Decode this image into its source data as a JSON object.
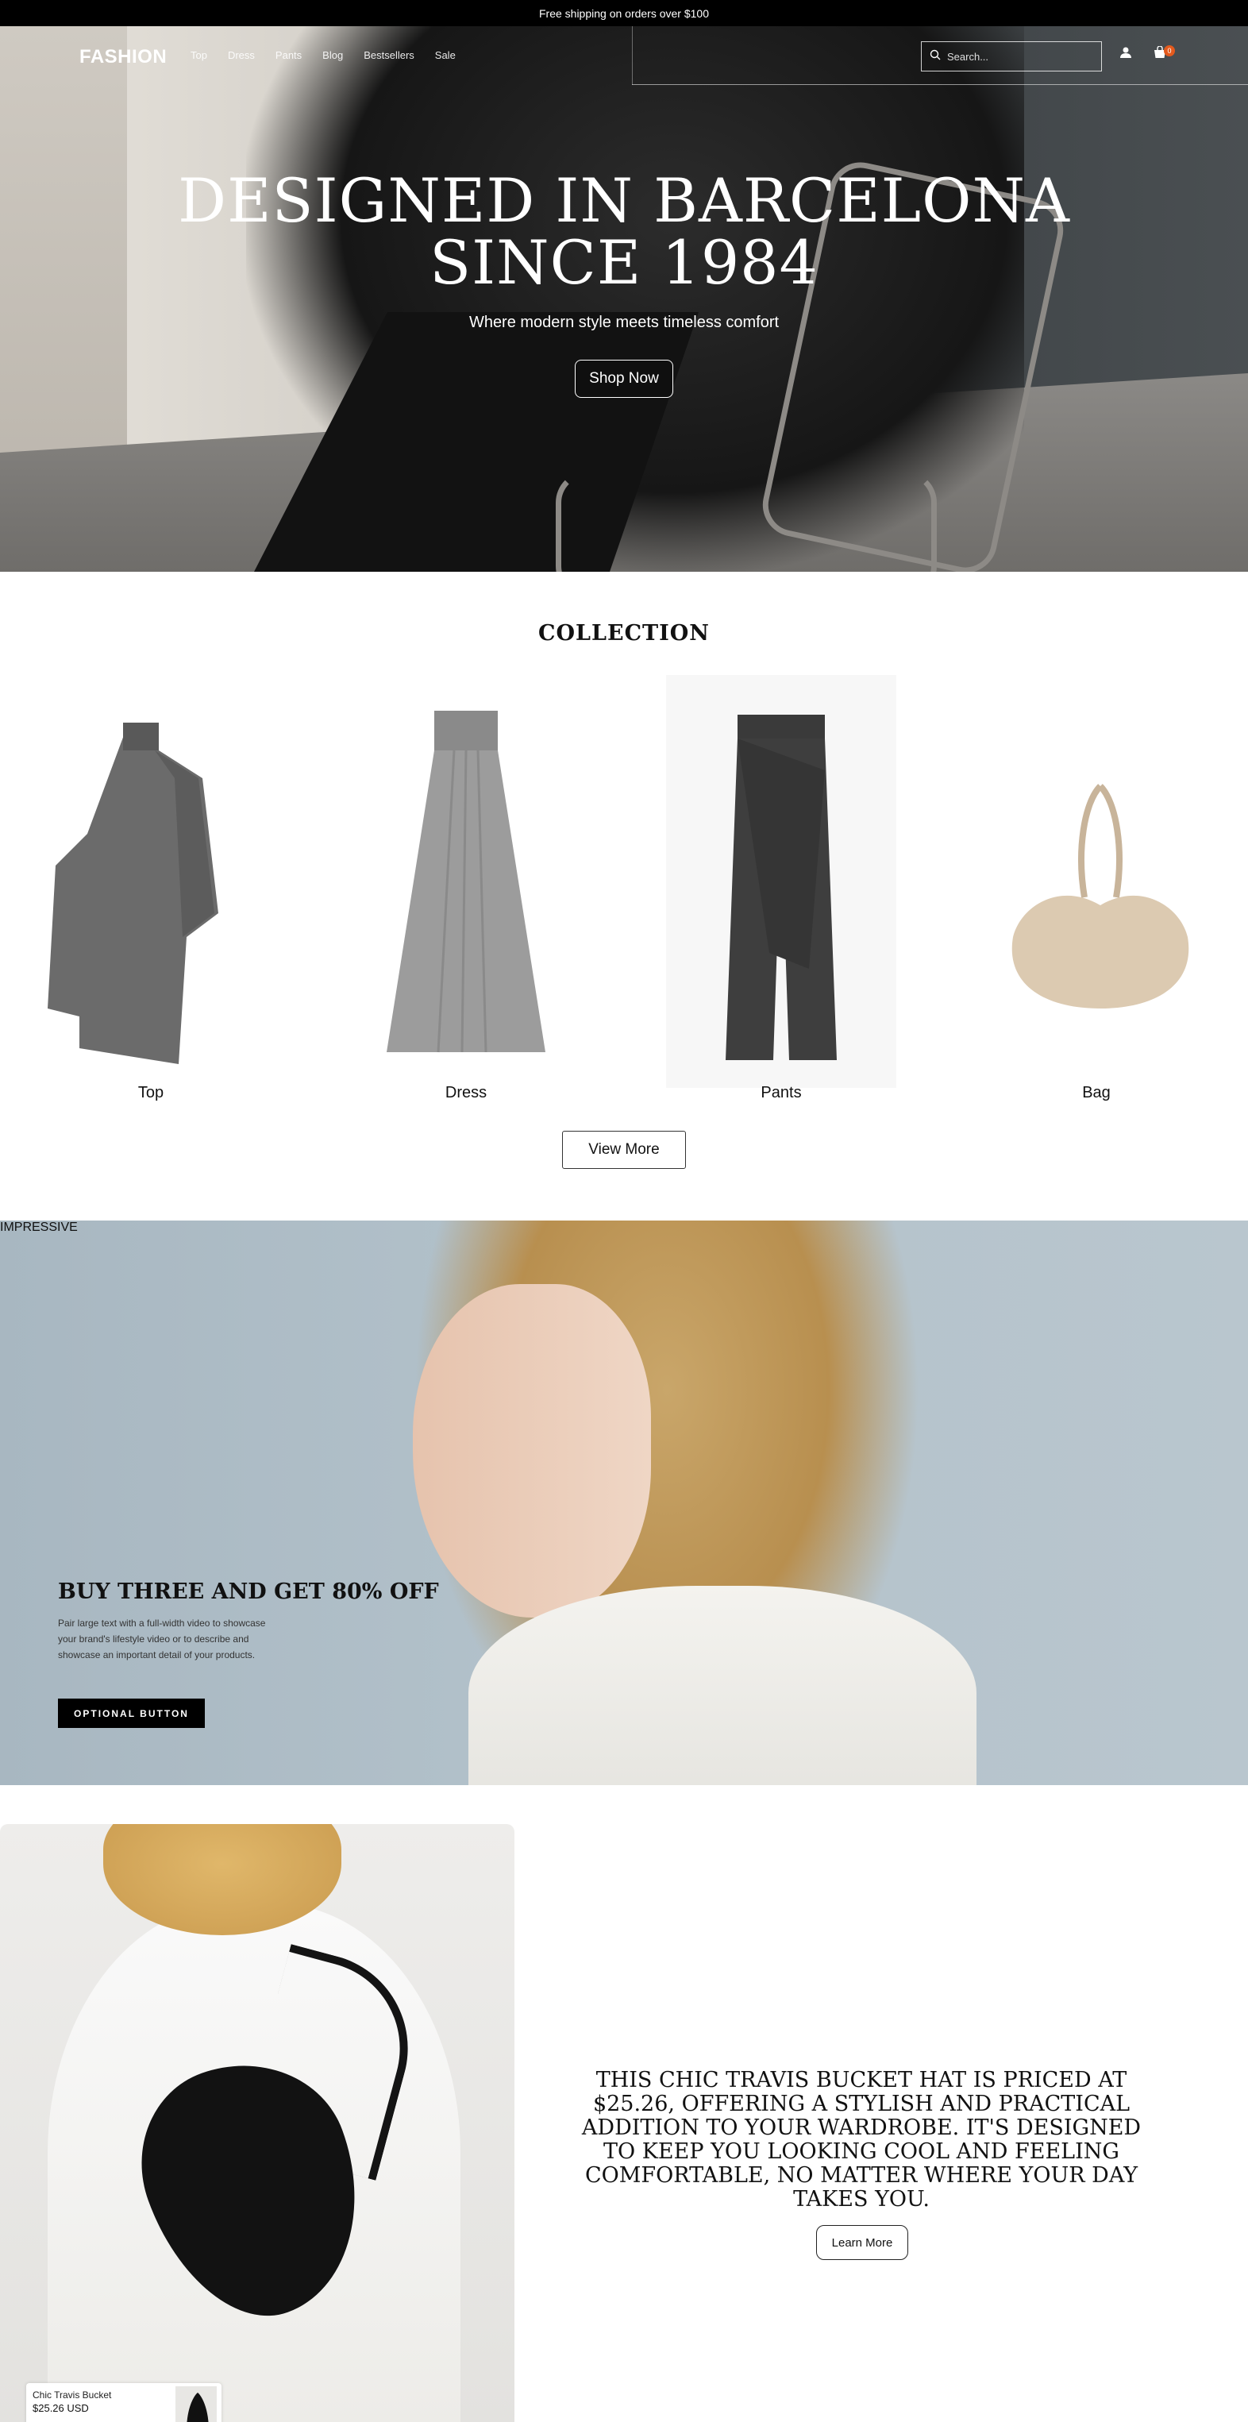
{
  "announcement": "Free shipping on orders over $100",
  "header": {
    "logo": "FASHION",
    "nav": [
      "Top",
      "Dress",
      "Pants",
      "Blog",
      "Bestsellers",
      "Sale"
    ],
    "search_placeholder": "Search...",
    "cart_count": "0"
  },
  "hero": {
    "title_line1": "DESIGNED IN BARCELONA",
    "title_line2": "SINCE 1984",
    "subtitle": "Where modern style meets timeless comfort",
    "cta": "Shop Now"
  },
  "collection": {
    "title": "COLLECTION",
    "items": [
      {
        "label": "Top"
      },
      {
        "label": "Dress"
      },
      {
        "label": "Pants"
      },
      {
        "label": "Bag"
      }
    ],
    "view_more": "View More"
  },
  "promo": {
    "kicker": "IMPRESSIVE",
    "heading": "BUY THREE AND GET 80% OFF",
    "body": "Pair large text with a full-width video to showcase your brand's lifestyle video or to describe and showcase an important detail of your products.",
    "button": "OPTIONAL BUTTON"
  },
  "feature": {
    "text": "THIS CHIC TRAVIS BUCKET HAT IS PRICED AT $25.26, OFFERING A STYLISH AND PRACTICAL ADDITION TO YOUR WARDROBE. IT'S DESIGNED TO KEEP YOU LOOKING COOL AND FEELING COMFORTABLE, NO MATTER WHERE YOUR DAY TAKES YOU.",
    "button": "Learn More",
    "product_name": "Chic Travis Bucket",
    "product_price": "$25.26 USD"
  },
  "colors": {
    "accent": "#e45a1d",
    "black": "#000000"
  },
  "icons": [
    "search-icon",
    "user-icon",
    "cart-icon"
  ]
}
